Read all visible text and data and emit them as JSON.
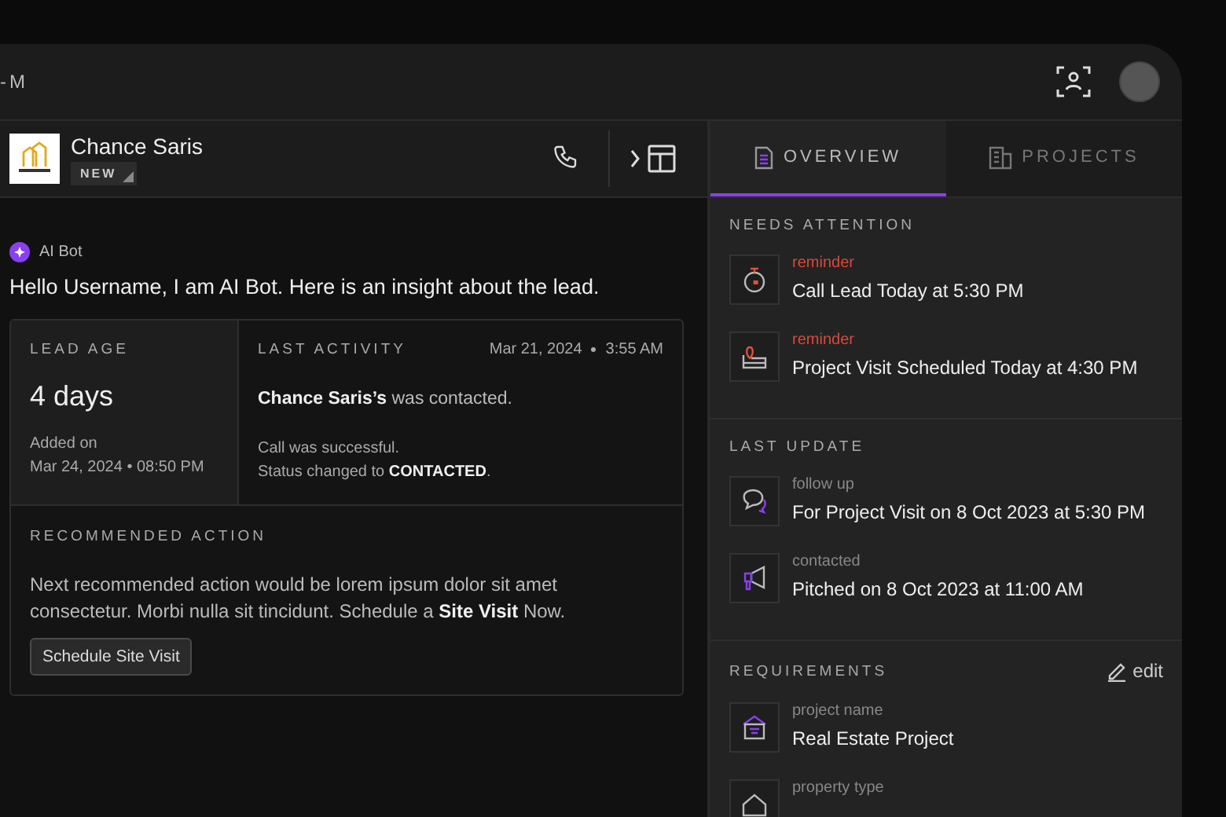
{
  "topbar": {
    "title": "-M"
  },
  "lead": {
    "name": "Chance Saris",
    "badge": "NEW"
  },
  "bot": {
    "name": "AI Bot",
    "greeting": "Hello Username, I am AI Bot. Here is an insight about the lead."
  },
  "lead_age": {
    "heading": "LEAD AGE",
    "value": "4 days",
    "added_label": "Added on",
    "added_date": "Mar 24, 2024 • 08:50 PM"
  },
  "last_activity": {
    "heading": "LAST ACTIVITY",
    "date": "Mar 21, 2024",
    "time": "3:55 AM",
    "summary": "**Chance Saris’s** was contacted.",
    "detail_1": "Call was successful.",
    "detail_2": "Status changed to **CONTACTED**."
  },
  "recommended_action": {
    "heading": "RECOMMENDED ACTION",
    "text": "Next recommended action would be lorem ipsum dolor sit amet consectetur. Morbi nulla sit tincidunt. Schedule a **Site Visit** Now.",
    "button": "Schedule Site Visit"
  },
  "tabs": [
    {
      "label": "OVERVIEW",
      "selected": true
    },
    {
      "label": "PROJECTS",
      "selected": false
    }
  ],
  "sections": [
    {
      "heading": "NEEDS ATTENTION",
      "items": [
        {
          "kind": "timer",
          "urgent": true,
          "label": "reminder",
          "value": "Call Lead Today at 5:30 PM"
        },
        {
          "kind": "visit",
          "urgent": true,
          "label": "reminder",
          "value": "Project Visit Scheduled Today at 4:30 PM"
        }
      ]
    },
    {
      "heading": "LAST UPDATE",
      "items": [
        {
          "kind": "chat",
          "urgent": false,
          "label": "follow up",
          "value": "For Project Visit on 8 Oct 2023 at 5:30 PM"
        },
        {
          "kind": "megaphone",
          "urgent": false,
          "label": "contacted",
          "value": "Pitched on 8 Oct 2023 at 11:00 AM"
        }
      ]
    },
    {
      "heading": "REQUIREMENTS",
      "action": "edit",
      "items": [
        {
          "kind": "sign",
          "urgent": false,
          "label": "project name",
          "value": "Real Estate Project"
        },
        {
          "kind": "house",
          "urgent": false,
          "label": "property type"
        }
      ]
    }
  ]
}
